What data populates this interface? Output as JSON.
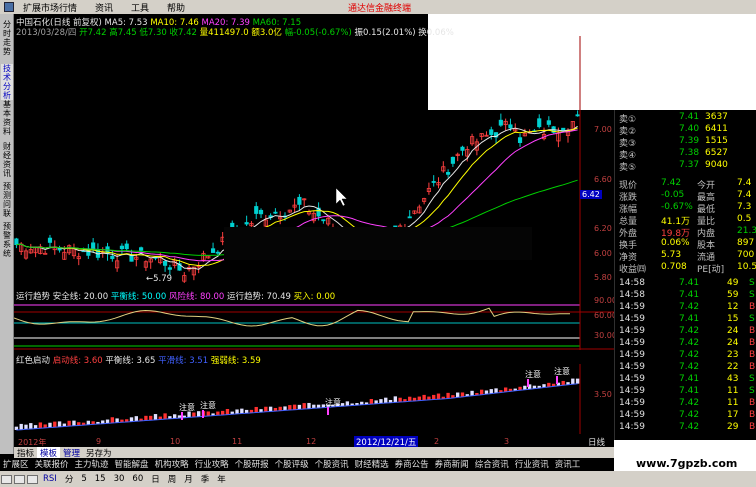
{
  "menubar": {
    "items": [
      "扩展市场行情",
      "资讯",
      "工具",
      "帮助"
    ],
    "ad_text": "通达信金融终端"
  },
  "vtabs": [
    "分时走势",
    "技术分析",
    "基本资料",
    "财经资讯",
    "预测问联",
    "预警系统"
  ],
  "header": {
    "line1": {
      "title": "中国石化(日线 前复权)",
      "ma5": "MA5: 7.53",
      "ma10": "MA10: 7.46",
      "ma20": "MA20: 7.39",
      "ma60": "MA60: 7.15"
    },
    "line2": {
      "date": "2013/03/28/四",
      "open": "开7.42",
      "high": "高7.45",
      "low": "低7.30",
      "close": "收7.42",
      "volume": "量411497.0",
      "amount": "额3.0亿",
      "change": "幅-0.05(-0.67%)",
      "amplitude": "振0.15(2.01%)",
      "turnover": "换0.06%"
    }
  },
  "main_chart": {
    "price_labels": [
      "7.00",
      "6.80",
      "6.60",
      "6.40",
      "6.20",
      "6.00",
      "5.80"
    ],
    "low_marker": "←5.79",
    "current_price_badge": "6.42"
  },
  "indicator1": {
    "name": "运行趋势",
    "safe": "安全线: 20.00",
    "balance": "平衡线: 50.00",
    "risk": "风险线: 80.00",
    "trend": "运行趋势: 70.49",
    "buy": "买入: 0.00",
    "labels": [
      "90.00",
      "60.00",
      "30.00"
    ]
  },
  "indicator2": {
    "name": "红色启动",
    "start": "启动线: 3.60",
    "balance": "平衡线: 3.65",
    "flat": "平滑线: 3.51",
    "strong": "强弱线: 3.59",
    "labels": [
      "3.50"
    ],
    "markers": [
      "注意",
      "注意",
      "注意",
      "注意",
      "注意"
    ]
  },
  "x_axis": {
    "labels": [
      "2012年",
      "9",
      "10",
      "11",
      "12",
      "2",
      "3"
    ],
    "date_badge": "2012/12/21/五"
  },
  "order_book": {
    "sells": [
      {
        "label": "卖①",
        "price": "7.41",
        "vol": "3637"
      },
      {
        "label": "卖②",
        "price": "7.40",
        "vol": "6411"
      },
      {
        "label": "卖③",
        "price": "7.39",
        "vol": "1515"
      },
      {
        "label": "卖④",
        "price": "7.38",
        "vol": "6527"
      },
      {
        "label": "卖⑤",
        "price": "7.37",
        "vol": "9040"
      }
    ],
    "stats": [
      {
        "k1": "现价",
        "v1": "7.42",
        "k2": "今开",
        "v2": "7.4"
      },
      {
        "k1": "涨跌",
        "v1": "-0.05",
        "k2": "最高",
        "v2": "7.4"
      },
      {
        "k1": "涨幅",
        "v1": "-0.67%",
        "k2": "最低",
        "v2": "7.3"
      },
      {
        "k1": "总量",
        "v1": "41.1万",
        "k2": "量比",
        "v2": "0.5"
      },
      {
        "k1": "外盘",
        "v1": "19.8万",
        "k2": "内盘",
        "v2": "21.3"
      },
      {
        "k1": "换手",
        "v1": "0.06%",
        "k2": "股本",
        "v2": "897"
      },
      {
        "k1": "净资",
        "v1": "5.73",
        "k2": "流通",
        "v2": "700"
      },
      {
        "k1": "收益㈣",
        "v1": "0.708",
        "k2": "PE[动]",
        "v2": "10.5"
      }
    ],
    "ticks": [
      {
        "time": "14:58",
        "price": "7.41",
        "vol": "49",
        "dir": "S"
      },
      {
        "time": "14:58",
        "price": "7.41",
        "vol": "59",
        "dir": "S"
      },
      {
        "time": "14:59",
        "price": "7.42",
        "vol": "12",
        "dir": "B"
      },
      {
        "time": "14:59",
        "price": "7.41",
        "vol": "15",
        "dir": "S"
      },
      {
        "time": "14:59",
        "price": "7.42",
        "vol": "24",
        "dir": "B"
      },
      {
        "time": "14:59",
        "price": "7.42",
        "vol": "24",
        "dir": "B"
      },
      {
        "time": "14:59",
        "price": "7.42",
        "vol": "23",
        "dir": "B"
      },
      {
        "time": "14:59",
        "price": "7.42",
        "vol": "22",
        "dir": "B"
      },
      {
        "time": "14:59",
        "price": "7.41",
        "vol": "43",
        "dir": "S"
      },
      {
        "time": "14:59",
        "price": "7.41",
        "vol": "11",
        "dir": "S"
      },
      {
        "time": "14:59",
        "price": "7.42",
        "vol": "11",
        "dir": "B"
      },
      {
        "time": "14:59",
        "price": "7.42",
        "vol": "17",
        "dir": "B"
      },
      {
        "time": "14:59",
        "price": "7.42",
        "vol": "29",
        "dir": "B"
      },
      {
        "time": "14:59",
        "price": "7.42",
        "vol": "22",
        "dir": "B"
      },
      {
        "time": "14:59",
        "price": "7.42",
        "vol": "14",
        "dir": "B"
      },
      {
        "time": "14:59",
        "price": "7.42",
        "vol": "12",
        "dir": "B"
      },
      {
        "time": "14:59",
        "price": "7.42",
        "vol": "55",
        "dir": "B"
      },
      {
        "time": "14:59",
        "price": "7.42",
        "vol": "28",
        "dir": "B"
      },
      {
        "time": "14:59",
        "price": "7.42",
        "vol": "14",
        "dir": "B"
      },
      {
        "time": "14:59",
        "price": "7.42",
        "vol": "18",
        "dir": "B"
      },
      {
        "time": "14:59",
        "price": "7.42",
        "vol": "16",
        "dir": "B"
      },
      {
        "time": "14:59",
        "price": "7.42",
        "vol": "21",
        "dir": "B"
      }
    ]
  },
  "bottom": {
    "tabs1": [
      "指标",
      "模板",
      "管理",
      "另存为"
    ],
    "tabs1_right": "日线",
    "tabs2": [
      "扩展区",
      "关联报价",
      "主力轨迹",
      "智能解盘",
      "机构攻略",
      "行业攻略",
      "个股研报",
      "个股评级",
      "个股资讯",
      "财经精选",
      "券商公告",
      "券商新闻",
      "综合资讯",
      "行业资讯",
      "资讯工"
    ],
    "status_items": [
      "RSI",
      "分",
      "5",
      "15",
      "30",
      "60",
      "日",
      "周",
      "月",
      "季",
      "年"
    ],
    "watermark": "www.7gpzb.com"
  },
  "colors": {
    "up": "#ff4040",
    "down": "#00d0d0",
    "ma5": "#e6e6e6",
    "ma10": "#ffff00",
    "ma20": "#ff40ff",
    "ma60": "#00d000"
  }
}
